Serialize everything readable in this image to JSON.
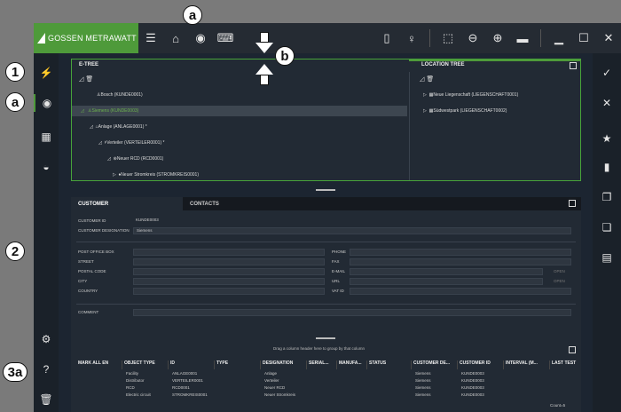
{
  "brand": {
    "name": "GOSSEN METRAWATT",
    "accent": "#4e9a3a"
  },
  "callouts": {
    "a1": "a",
    "a2": "a",
    "one": "1",
    "two": "2",
    "three_a": "3a",
    "b": "b"
  },
  "topbar_icons": [
    "menu-icon",
    "home-icon",
    "device-icon",
    "keyboard-icon",
    "book-icon",
    "bulb-icon",
    "cursor-icon",
    "zoom-out-icon",
    "zoom-in-icon",
    "window-icon",
    "minimize-icon",
    "maximize-icon",
    "close-icon"
  ],
  "etree": {
    "title": "E-TREE",
    "rows": [
      {
        "label": "Bosch (KUNDE0001)"
      },
      {
        "label": "Siemens (KUNDE0003)",
        "selected": true
      },
      {
        "label": "Anlage (ANLAGE0001) *"
      },
      {
        "label": "Verteiler (VERTEILER0001) *"
      },
      {
        "label": "Neuer RCD (RCD0001)"
      },
      {
        "label": "Neuer Stromkreis (STROMKREIS0001)"
      }
    ]
  },
  "location_tree": {
    "title": "LOCATION TREE",
    "rows": [
      {
        "label": "Neue Liegenschaft (LIEGENSCHAFT0001)"
      },
      {
        "label": "Südwestpark (LIEGENSCHAFT0002)"
      }
    ]
  },
  "customer_panel": {
    "tabs": [
      "CUSTOMER",
      "CONTACTS"
    ],
    "customer_id_label": "CUSTOMER ID",
    "customer_id": "KUNDE0003",
    "designation_label": "CUSTOMER DESIGNATION",
    "designation": "Siemens",
    "left_fields": [
      "POST OFFICE BOX",
      "STREET",
      "POSTAL CODE",
      "CITY",
      "COUNTRY"
    ],
    "right_fields": [
      "PHONE",
      "FAX",
      "E-MAIL",
      "URL",
      "VAT ID"
    ],
    "open_label": "OPEN",
    "comment_label": "COMMENT"
  },
  "grid": {
    "group_hint": "Drag a column header here to group by that column",
    "columns": [
      "MARK ALL EN",
      "OBJECT TYPE",
      "ID",
      "TYPE",
      "DESIGNATION",
      "SERIAL...",
      "MANUFA...",
      "STATUS",
      "CUSTOMER DE...",
      "CUSTOMER ID",
      "INTERVAL (M...",
      "LAST TEST"
    ],
    "rows": [
      {
        "type": "Facility",
        "id": "ANLAGE0001",
        "designation": "Anlage",
        "customer": "Siemens",
        "customer_id": "KUNDE0003"
      },
      {
        "type": "Distributor",
        "id": "VERTEILER0001",
        "designation": "Verteiler",
        "customer": "Siemens",
        "customer_id": "KUNDE0003"
      },
      {
        "type": "RCD",
        "id": "RCD0001",
        "designation": "Neuer RCD",
        "customer": "Siemens",
        "customer_id": "KUNDE0003"
      },
      {
        "type": "Electric circuit",
        "id": "STROMKREIS0001",
        "designation": "Neuer Stromkreis",
        "customer": "Siemens",
        "customer_id": "KUNDE0003"
      }
    ],
    "count": "Count=5"
  }
}
